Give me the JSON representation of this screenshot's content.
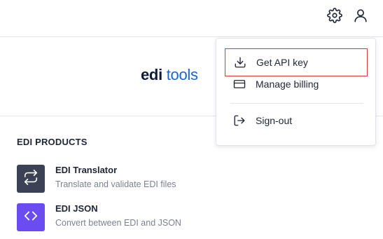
{
  "header": {
    "settings_icon": "gear-icon",
    "user_icon": "user-icon"
  },
  "logo": {
    "part1": "edi",
    "part2": "tools",
    "color_primary": "#101a3b",
    "color_accent": "#1a63d6"
  },
  "products": {
    "title": "EDI PRODUCTS",
    "items": [
      {
        "name": "EDI Translator",
        "description": "Translate and validate EDI files",
        "icon": "swap-arrows-icon",
        "color": "#3b4256"
      },
      {
        "name": "EDI JSON",
        "description": "Convert between EDI and JSON",
        "icon": "code-brackets-icon",
        "color": "#6a4cf0"
      }
    ]
  },
  "user_menu": {
    "items": [
      {
        "label": "Get API key",
        "icon": "download-icon",
        "highlighted": true
      },
      {
        "label": "Manage billing",
        "icon": "credit-card-icon"
      },
      {
        "label": "Sign-out",
        "icon": "sign-out-icon"
      }
    ]
  }
}
